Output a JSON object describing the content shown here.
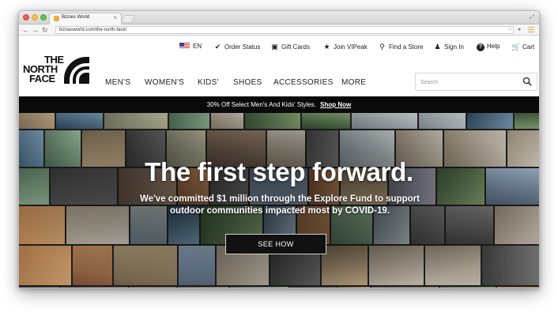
{
  "browser": {
    "tab_title": "Biznes World",
    "url": "biznasworld.com/the-north-face/"
  },
  "utility_nav": {
    "language": "EN",
    "items": [
      {
        "label": "Order Status",
        "icon": "checkmark-icon"
      },
      {
        "label": "Gift Cards",
        "icon": "gift-card-icon"
      },
      {
        "label": "Join VIPeak",
        "icon": "star-icon"
      },
      {
        "label": "Find a Store",
        "icon": "location-pin-icon"
      },
      {
        "label": "Sign In",
        "icon": "user-icon"
      },
      {
        "label": "Help",
        "icon": "help-icon"
      },
      {
        "label": "Cart",
        "icon": "cart-icon"
      }
    ]
  },
  "logo": {
    "line1": "THE",
    "line2": "NORTH",
    "line3": "FACE"
  },
  "main_nav": {
    "items": [
      "MEN'S",
      "WOMEN'S",
      "KIDS'",
      "SHOES",
      "ACCESSORIES",
      "MORE"
    ]
  },
  "search": {
    "placeholder": "Search"
  },
  "promo": {
    "text": "30% Off Select Men's And Kids' Styles.",
    "link": "Shop Now"
  },
  "hero": {
    "title": "The first step forward.",
    "subtitle": "We've committed $1 million through the Explore Fund to support outdoor communities impacted most by COVID-19.",
    "button": "SEE HOW"
  },
  "colors": {
    "promo_bg": "#0a0a0a",
    "text": "#222222",
    "tab_accent": "#f0a93a"
  }
}
